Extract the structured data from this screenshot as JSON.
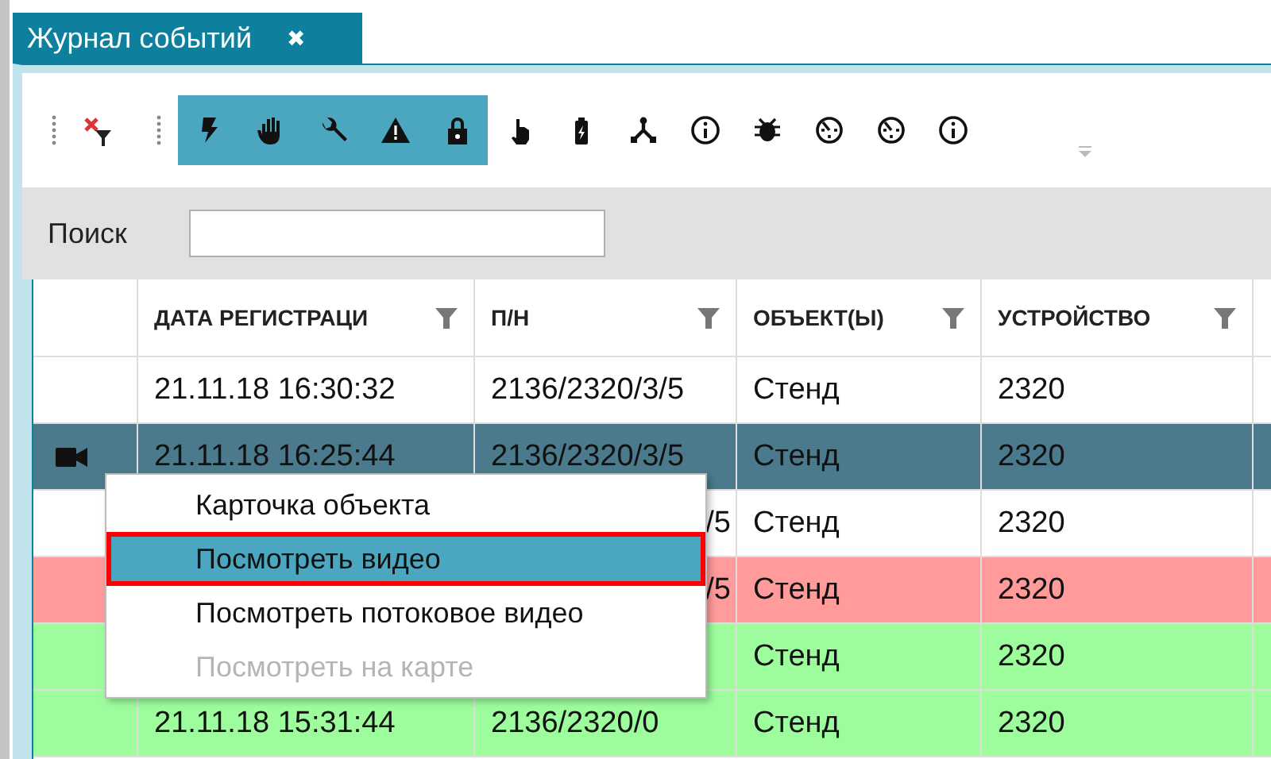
{
  "tab": {
    "title": "Журнал событий",
    "close": "✖"
  },
  "toolbar": {
    "buttons": [
      {
        "kind": "lightning",
        "selected": true
      },
      {
        "kind": "hand",
        "selected": true
      },
      {
        "kind": "wrench",
        "selected": true
      },
      {
        "kind": "warning",
        "selected": true
      },
      {
        "kind": "lock",
        "selected": true
      },
      {
        "kind": "touch",
        "selected": false
      },
      {
        "kind": "battery",
        "selected": false
      },
      {
        "kind": "nodes",
        "selected": false
      },
      {
        "kind": "info",
        "selected": false
      },
      {
        "kind": "bug",
        "selected": false
      },
      {
        "kind": "timer",
        "selected": false
      },
      {
        "kind": "timer",
        "selected": false
      },
      {
        "kind": "info",
        "selected": false
      }
    ]
  },
  "search": {
    "label": "Поиск"
  },
  "table": {
    "columns": [
      "ДАТА РЕГИСТРАЦИ",
      "П/Н",
      "ОБЪЕКТ(Ы)",
      "УСТРОЙСТВО"
    ],
    "rows": [
      {
        "color": "#ffffff",
        "selected": false,
        "video": false,
        "cells": [
          {
            "text": "21.11.18 16:30:32"
          },
          {
            "text": "2136/2320/3/5"
          },
          {
            "text": "Стенд"
          },
          {
            "text": "2320"
          }
        ]
      },
      {
        "selected": true,
        "video": true,
        "cells": [
          {
            "text": "21.11.18 16:25:44"
          },
          {
            "text": "2136/2320/3/5"
          },
          {
            "text": "Стенд"
          },
          {
            "text": "2320"
          }
        ]
      },
      {
        "color": "#ffffff",
        "selected": false,
        "video": false,
        "cells": [
          {},
          {
            "text": "/5",
            "clipped": true
          },
          {
            "text": "Стенд"
          },
          {
            "text": "2320"
          }
        ]
      },
      {
        "color": "#ff9b9b",
        "selected": false,
        "video": false,
        "cells": [
          {},
          {
            "text": "/5",
            "clipped": true
          },
          {
            "text": "Стенд"
          },
          {
            "text": "2320"
          }
        ]
      },
      {
        "color": "#9dfd9d",
        "selected": false,
        "video": false,
        "cells": [
          {},
          {},
          {
            "text": "Стенд"
          },
          {
            "text": "2320"
          }
        ]
      },
      {
        "color": "#9dfd9d",
        "selected": false,
        "video": false,
        "cells": [
          {
            "text": "21.11.18 15:31:44"
          },
          {
            "text": "2136/2320/0"
          },
          {
            "text": "Стенд"
          },
          {
            "text": "2320"
          }
        ]
      }
    ]
  },
  "context_menu": {
    "items": [
      {
        "label": "Карточка объекта",
        "selected": false,
        "disabled": false
      },
      {
        "label": "Посмотреть видео",
        "selected": true,
        "disabled": false
      },
      {
        "label": "Посмотреть потоковое видео",
        "selected": false,
        "disabled": false
      },
      {
        "label": "Посмотреть на карте",
        "selected": false,
        "disabled": true
      }
    ]
  }
}
